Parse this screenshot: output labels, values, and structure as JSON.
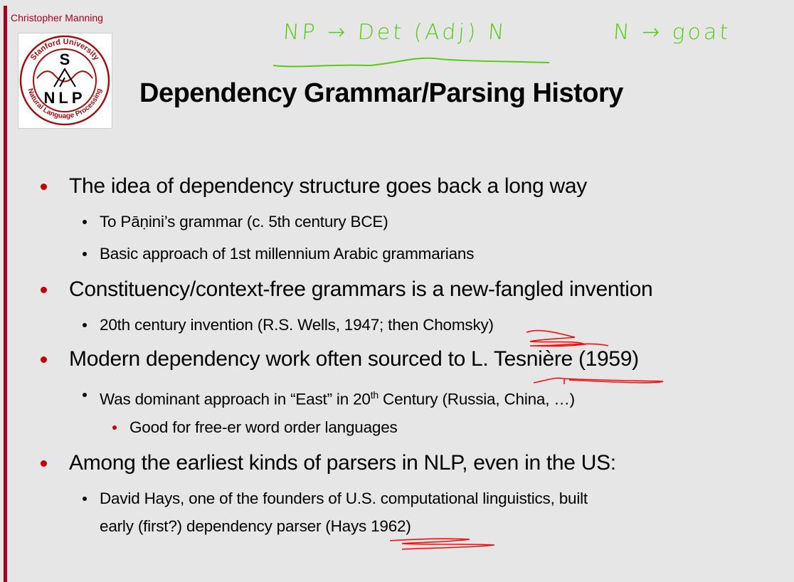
{
  "header": {
    "author": "Christopher Manning",
    "logo_text": {
      "top": "Stanford University",
      "bottom": "Natural Language Processing",
      "center": "S NLP"
    }
  },
  "slide": {
    "title": "Dependency Grammar/Parsing History",
    "bullets": [
      {
        "text": "The idea of dependency structure goes back a long way"
      },
      {
        "text": "To Pāṇini’s grammar (c. 5th century BCE)"
      },
      {
        "text": "Basic approach of 1st millennium Arabic grammarians"
      },
      {
        "text": "Constituency/context-free grammars is a new-fangled invention"
      },
      {
        "text": "20th century invention (R.S. Wells, 1947; then Chomsky)"
      },
      {
        "text": "Modern dependency work often sourced to L. Tesnière (1959)"
      },
      {
        "text_before": "Was dominant approach in “East” in 20",
        "sup": "th",
        "text_after": " Century (Russia, China, …)"
      },
      {
        "text": "Good for free-er word order languages"
      },
      {
        "text": "Among the earliest kinds of parsers in NLP, even in the US:"
      },
      {
        "text": "David Hays, one of the founders of U.S. computational linguistics, built"
      },
      {
        "text": "early (first?) dependency parser (Hays 1962)"
      }
    ]
  },
  "annotations": {
    "rule1": "NP → Det (Adj) N",
    "rule2": "N → goat",
    "ink_green": "#55cc11",
    "ink_red": "#ee1111"
  },
  "colors": {
    "accent": "#a50021",
    "bullet_red": "#c00000",
    "background": "#e6e6e6"
  }
}
